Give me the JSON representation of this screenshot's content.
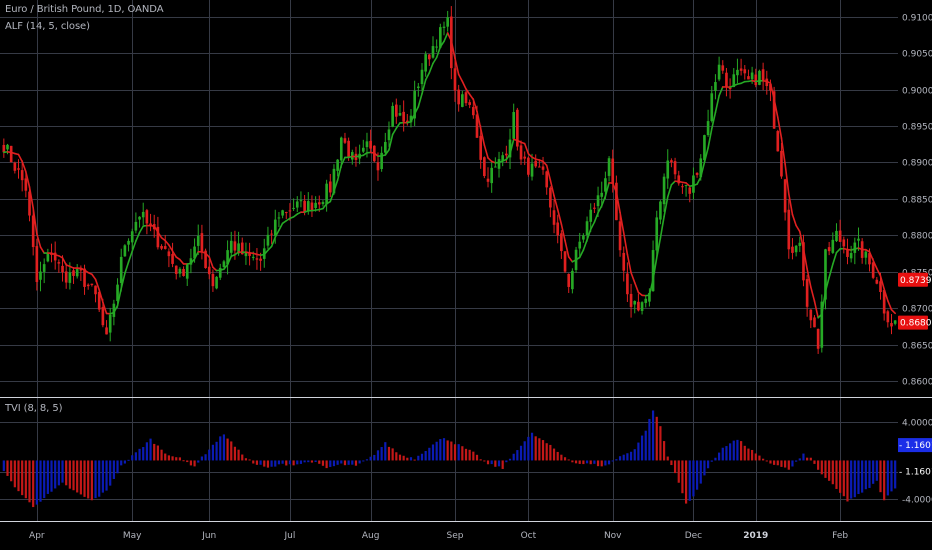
{
  "header": {
    "symbol_title": "Euro / British Pound, 1D, OANDA",
    "alf_indicator": "ALF (14, 5, close)",
    "tvi_indicator": "TVI (8, 8, 5)"
  },
  "colors": {
    "background": "#000000",
    "grid": "#363a45",
    "bull_candle": "#26a925",
    "bear_candle": "#e02020",
    "tvi_positive": "#0b1bb5",
    "tvi_negative": "#c41818",
    "price_tag_red": "#e81010",
    "tvi_tag_blue": "#1b2ee8",
    "text": "#b2b5be",
    "separator": "#d1d4dc"
  },
  "chart_data": [
    {
      "type": "candlestick",
      "symbol": "Euro / British Pound, 1D, OANDA",
      "y_axis": {
        "ticks": [
          "0.91000",
          "0.90500",
          "0.90000",
          "0.89500",
          "0.89000",
          "0.88500",
          "0.88000",
          "0.87500",
          "0.87000",
          "0.86500",
          "0.86000"
        ],
        "range": [
          0.8585,
          0.9112
        ]
      },
      "x_axis": {
        "ticks": [
          {
            "label": "Apr",
            "index": 9,
            "bold": false
          },
          {
            "label": "May",
            "index": 35,
            "bold": false
          },
          {
            "label": "Jun",
            "index": 56,
            "bold": false
          },
          {
            "label": "Jul",
            "index": 78,
            "bold": false
          },
          {
            "label": "Aug",
            "index": 100,
            "bold": false
          },
          {
            "label": "Sep",
            "index": 123,
            "bold": false
          },
          {
            "label": "Oct",
            "index": 143,
            "bold": false
          },
          {
            "label": "Nov",
            "index": 166,
            "bold": false
          },
          {
            "label": "Dec",
            "index": 188,
            "bold": false
          },
          {
            "label": "2019",
            "index": 205,
            "bold": true
          },
          {
            "label": "Feb",
            "index": 228,
            "bold": false
          }
        ]
      },
      "keypoints": [
        [
          0,
          0.8925
        ],
        [
          6,
          0.8865
        ],
        [
          9,
          0.8735
        ],
        [
          13,
          0.878
        ],
        [
          16,
          0.8745
        ],
        [
          21,
          0.8745
        ],
        [
          25,
          0.8715
        ],
        [
          28,
          0.8655
        ],
        [
          33,
          0.879
        ],
        [
          37,
          0.883
        ],
        [
          41,
          0.88
        ],
        [
          44,
          0.878
        ],
        [
          48,
          0.8745
        ],
        [
          53,
          0.879
        ],
        [
          57,
          0.8735
        ],
        [
          62,
          0.879
        ],
        [
          66,
          0.877
        ],
        [
          70,
          0.8765
        ],
        [
          75,
          0.883
        ],
        [
          79,
          0.884
        ],
        [
          83,
          0.884
        ],
        [
          86,
          0.885
        ],
        [
          89,
          0.8865
        ],
        [
          92,
          0.8935
        ],
        [
          96,
          0.8895
        ],
        [
          99,
          0.892
        ],
        [
          102,
          0.89
        ],
        [
          106,
          0.8975
        ],
        [
          110,
          0.895
        ],
        [
          114,
          0.903
        ],
        [
          118,
          0.907
        ],
        [
          121,
          0.909
        ],
        [
          123,
          0.899
        ],
        [
          126,
          0.898
        ],
        [
          128,
          0.897
        ],
        [
          131,
          0.888
        ],
        [
          134,
          0.889
        ],
        [
          137,
          0.892
        ],
        [
          139,
          0.896
        ],
        [
          141,
          0.89
        ],
        [
          144,
          0.889
        ],
        [
          147,
          0.888
        ],
        [
          150,
          0.882
        ],
        [
          152,
          0.877
        ],
        [
          154,
          0.8735
        ],
        [
          157,
          0.879
        ],
        [
          160,
          0.883
        ],
        [
          163,
          0.886
        ],
        [
          165,
          0.891
        ],
        [
          167,
          0.881
        ],
        [
          170,
          0.871
        ],
        [
          173,
          0.8705
        ],
        [
          176,
          0.8715
        ],
        [
          178,
          0.8825
        ],
        [
          181,
          0.891
        ],
        [
          184,
          0.887
        ],
        [
          187,
          0.886
        ],
        [
          190,
          0.891
        ],
        [
          193,
          0.899
        ],
        [
          195,
          0.904
        ],
        [
          197,
          0.9005
        ],
        [
          200,
          0.902
        ],
        [
          203,
          0.901
        ],
        [
          206,
          0.902
        ],
        [
          209,
          0.899
        ],
        [
          212,
          0.889
        ],
        [
          214,
          0.879
        ],
        [
          217,
          0.878
        ],
        [
          219,
          0.871
        ],
        [
          222,
          0.865
        ],
        [
          224,
          0.877
        ],
        [
          227,
          0.88
        ],
        [
          230,
          0.878
        ],
        [
          233,
          0.8785
        ],
        [
          236,
          0.876
        ],
        [
          238,
          0.874
        ],
        [
          240,
          0.87
        ],
        [
          242,
          0.868
        ]
      ],
      "series": [
        {
          "name": "ALF (14, 5, close)",
          "type": "line",
          "colors": {
            "rising": "#26a925",
            "falling": "#e02020"
          }
        }
      ],
      "last_price_tags": [
        {
          "value": "0.87390",
          "color": "#e81010"
        },
        {
          "value": "0.86802",
          "color": "#e81010"
        }
      ],
      "candle_count": 244
    },
    {
      "type": "bar",
      "indicator": "TVI (8, 8, 5)",
      "y_axis": {
        "ticks": [
          "4.00000",
          "-1.16013",
          "-4.00000"
        ],
        "range": [
          -6.0,
          6.2
        ]
      },
      "zero_line_value": -1.16013,
      "current_value_tags": [
        {
          "value": "- 1.16013",
          "color": "#1b2ee8"
        },
        {
          "value": "- 1.16013",
          "color": "#000000"
        }
      ],
      "keypoints": [
        [
          0,
          -1.2
        ],
        [
          4,
          -3.2
        ],
        [
          8,
          -4.8
        ],
        [
          12,
          -3.6
        ],
        [
          16,
          -2.4
        ],
        [
          20,
          -3.4
        ],
        [
          24,
          -4.2
        ],
        [
          28,
          -3.2
        ],
        [
          32,
          -0.6
        ],
        [
          36,
          0.8
        ],
        [
          40,
          2.2
        ],
        [
          44,
          0.8
        ],
        [
          48,
          0.2
        ],
        [
          52,
          -0.6
        ],
        [
          56,
          1.2
        ],
        [
          60,
          2.8
        ],
        [
          64,
          1.0
        ],
        [
          68,
          -0.3
        ],
        [
          72,
          -0.8
        ],
        [
          76,
          -0.4
        ],
        [
          80,
          -0.4
        ],
        [
          84,
          -0.1
        ],
        [
          88,
          -0.8
        ],
        [
          92,
          -0.4
        ],
        [
          96,
          -0.6
        ],
        [
          100,
          0.3
        ],
        [
          104,
          1.8
        ],
        [
          108,
          0.6
        ],
        [
          112,
          0.2
        ],
        [
          116,
          1.4
        ],
        [
          120,
          2.4
        ],
        [
          124,
          1.6
        ],
        [
          128,
          0.8
        ],
        [
          132,
          -0.4
        ],
        [
          136,
          -0.8
        ],
        [
          140,
          1.2
        ],
        [
          144,
          2.8
        ],
        [
          148,
          1.8
        ],
        [
          152,
          0.6
        ],
        [
          156,
          -0.3
        ],
        [
          160,
          -0.4
        ],
        [
          164,
          -0.6
        ],
        [
          168,
          0.4
        ],
        [
          172,
          1.2
        ],
        [
          175,
          3.2
        ],
        [
          177,
          5.3
        ],
        [
          179,
          3.6
        ],
        [
          181,
          0.4
        ],
        [
          184,
          -2.2
        ],
        [
          186,
          -4.6
        ],
        [
          188,
          -3.8
        ],
        [
          192,
          -0.8
        ],
        [
          196,
          1.4
        ],
        [
          200,
          2.2
        ],
        [
          204,
          1.0
        ],
        [
          208,
          -0.2
        ],
        [
          212,
          -0.6
        ],
        [
          214,
          -1.0
        ],
        [
          218,
          0.6
        ],
        [
          220,
          0.2
        ],
        [
          222,
          -1.0
        ],
        [
          226,
          -2.6
        ],
        [
          230,
          -4.2
        ],
        [
          234,
          -3.4
        ],
        [
          238,
          -2.2
        ],
        [
          240,
          -4.2
        ],
        [
          243,
          -2.8
        ]
      ]
    }
  ]
}
